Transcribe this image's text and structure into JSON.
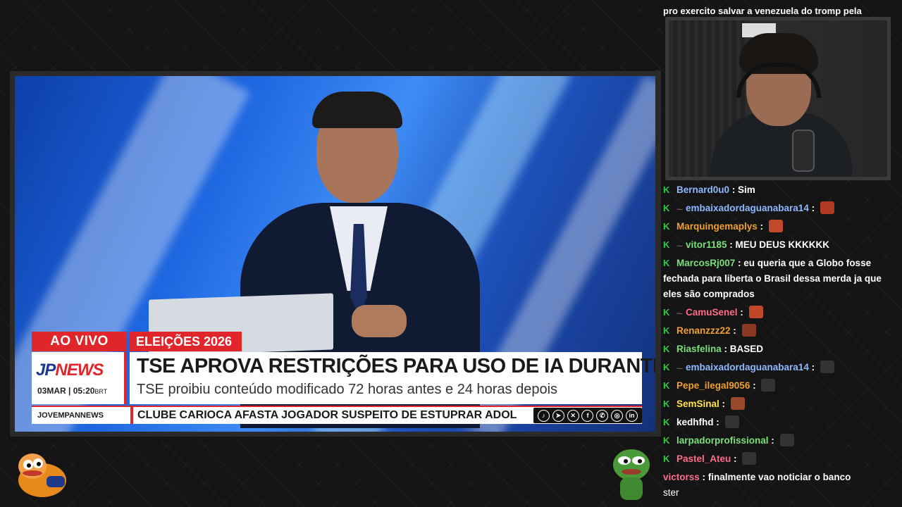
{
  "news": {
    "live_label": "AO VIVO",
    "category": "ELEIÇÕES 2026",
    "logo_jp": "JP",
    "logo_news": "NEWS",
    "date": "03MAR",
    "time": "05:20",
    "tz": "BRT",
    "headline": "TSE APROVA RESTRIÇÕES PARA USO DE IA DURANTE O PLEITO",
    "subheadline": "TSE proibiu conteúdo modificado 72 horas antes e 24 horas depois",
    "site": "JOVEMPANNEWS",
    "ticker": "CLUBE CARIOCA AFASTA JOGADOR SUSPEITO DE ESTUPRAR ADOL",
    "social": [
      "tiktok-icon",
      "telegram-icon",
      "x-icon",
      "facebook-icon",
      "whatsapp-icon",
      "instagram-icon",
      "linkedin-icon"
    ]
  },
  "chat": {
    "top_line": "pro exercito salvar a venezuela do tromp pela",
    "messages": [
      {
        "user": "Bernard0u0",
        "color": "#8fb8ff",
        "sub": false,
        "text": "Sim",
        "emote": null
      },
      {
        "user": "embaixadordaguanabara14",
        "color": "#8fb8ff",
        "sub": true,
        "text": "",
        "emote": "#b03a22"
      },
      {
        "user": "Marquingemaplys",
        "color": "#f0a030",
        "sub": false,
        "text": "",
        "emote": "#c04a2a"
      },
      {
        "user": "vitor1185",
        "color": "#7be07b",
        "sub": true,
        "text": "MEU DEUS KKKKKK",
        "emote": null
      },
      {
        "user": "MarcosRj007",
        "color": "#7be07b",
        "sub": false,
        "text": "eu queria que a Globo fosse fechada para liberta o Brasil dessa merda ja que eles são comprados",
        "emote": null
      },
      {
        "user": "CamuSenel",
        "color": "#ff6b8a",
        "sub": true,
        "text": "",
        "emote": "#c0482a"
      },
      {
        "user": "Renanzzz22",
        "color": "#f0a030",
        "sub": false,
        "text": "",
        "emote": "#8a3a22"
      },
      {
        "user": "Riasfelina",
        "color": "#7be07b",
        "sub": false,
        "text": "BASED",
        "emote": null
      },
      {
        "user": "embaixadordaguanabara14",
        "color": "#8fb8ff",
        "sub": true,
        "text": "",
        "emote": "#333333"
      },
      {
        "user": "Pepe_ilegal9056",
        "color": "#f0a030",
        "sub": false,
        "text": "",
        "emote": "#333333"
      },
      {
        "user": "SemSinal",
        "color": "#ffe44d",
        "sub": false,
        "text": "",
        "emote": "#9a4a2a"
      },
      {
        "user": "kedhfhd",
        "color": "#ffffff",
        "sub": false,
        "text": "",
        "emote": "#333333"
      },
      {
        "user": "larpadorprofissional",
        "color": "#7be07b",
        "sub": false,
        "text": "",
        "emote": "#333333"
      },
      {
        "user": "Pastel_Ateu",
        "color": "#ff6b8a",
        "sub": false,
        "text": "",
        "emote": "#333333"
      }
    ],
    "bottom_user": "victorss",
    "bottom_text": "finalmente vao noticiar o banco",
    "bottom_cont": "ster"
  }
}
